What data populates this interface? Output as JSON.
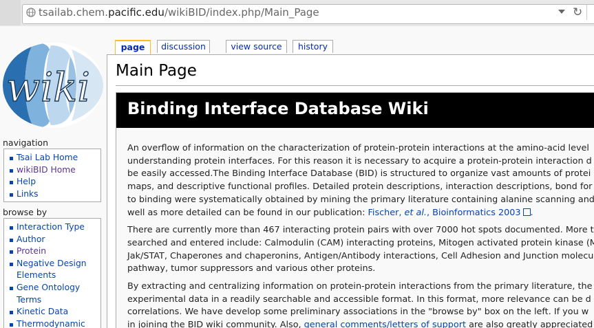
{
  "browser": {
    "url_prefix": "tsailab.chem.",
    "url_domain": "pacific.edu",
    "url_path": "/wikiBID/index.php/Main_Page"
  },
  "logo": {
    "text": "wiki"
  },
  "tabs": [
    {
      "label": "page",
      "selected": true
    },
    {
      "label": "discussion"
    },
    {
      "label": "view source"
    },
    {
      "label": "history"
    }
  ],
  "navigation": {
    "title": "navigation",
    "items": [
      "Tsai Lab Home",
      "wikiBID Home",
      "Help",
      "Links"
    ]
  },
  "browse_by": {
    "title": "browse by",
    "items": [
      "Interaction Type",
      "Author",
      "Protein",
      "Negative Design",
      "Elements",
      "Gene Ontology",
      "Terms",
      "Kinetic Data",
      "Thermodynamic"
    ]
  },
  "page": {
    "title": "Main Page",
    "banner": "Binding Interface Database Wiki",
    "paragraphs": [
      [
        "An overflow of information on the characterization of protein-protein interactions at the amino-acid level",
        "understanding protein interfaces. For this reason it is necessary to acquire a protein-protein interaction d",
        "be easily accessed.The Binding Interface Database (BID) is structured to organize vast amounts of protei",
        "maps, and descriptive functional profiles. Detailed protein descriptions, interaction descriptions, bond for",
        "to binding were systematically obtained by mining the primary literature containing alanine scanning and",
        "well as more detailed can be found in our publication: "
      ],
      [
        "There are currently more than 467 interacting protein pairs with over 7000 hot spots documented. More t",
        "searched and entered include: Calmodulin (CAM) interacting proteins, Mitogen activated protein kinase (M",
        "Jak/STAT, Chaperones and chaperonins, Antigen/Antibody interactions, Cell Adhesion and Junction molecu",
        "pathway, tumor suppressors and various other proteins."
      ],
      [
        "By extracting and centralizing information on protein-protein interactions from the primary literature, the",
        "experimental data in a readily searchable and accessible format. In this format, more relevance can be d",
        "correlations. We have develop some preliminary associations in the \"browse by\" box on the left. If you w",
        "in joining the BID wiki community. Also, "
      ]
    ],
    "citation_prefix": "Fischer, ",
    "citation_etal": "et al.",
    "citation_suffix": ", Bioinformatics 2003",
    "citation_end": ".",
    "comments_link": "general comments/letters of support",
    "comments_after": " are also greatly appreciated"
  }
}
